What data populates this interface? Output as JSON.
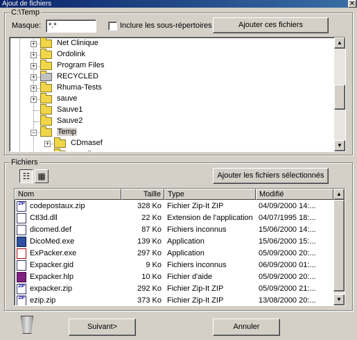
{
  "window": {
    "title": "Ajout de fichiers",
    "close_glyph": "✕"
  },
  "top_group": {
    "label": "C:\\Temp",
    "mask_label": "Masque:",
    "mask_value": "*.*",
    "include_subdirs_label": "Inclure les sous-répertoires",
    "include_subdirs_checked": false,
    "add_button": "Ajouter ces fichiers"
  },
  "tree": {
    "items": [
      {
        "label": "Net Clinique",
        "expandable": true
      },
      {
        "label": "Ordolink",
        "expandable": true
      },
      {
        "label": "Program Files",
        "expandable": true
      },
      {
        "label": "RECYCLED",
        "expandable": true,
        "icon": "recycle-bin-icon"
      },
      {
        "label": "Rhuma-Tests",
        "expandable": true
      },
      {
        "label": "sauve",
        "expandable": true
      },
      {
        "label": "Sauve1",
        "expandable": false
      },
      {
        "label": "Sauve2",
        "expandable": false
      },
      {
        "label": "Temp",
        "expandable": true,
        "expanded": true,
        "selected": true
      },
      {
        "label": "CDmasef",
        "expandable": true,
        "child": true
      },
      {
        "label": "travail",
        "expandable": false,
        "child": true
      }
    ]
  },
  "files_group": {
    "label": "Fichiers",
    "add_selected_button": "Ajouter les fichiers sélectionnés",
    "columns": [
      "Nom",
      "Taille",
      "Type",
      "Modifié"
    ],
    "rows": [
      {
        "name": "codepostaux.zip",
        "size": "328 Ko",
        "type": "Fichier Zip-It ZIP",
        "modified": "04/09/2000 14:...",
        "icon": "zip"
      },
      {
        "name": "Ctl3d.dll",
        "size": "22 Ko",
        "type": "Extension de l'application",
        "modified": "04/07/1995 18:...",
        "icon": "dll"
      },
      {
        "name": "dicomed.def",
        "size": "87 Ko",
        "type": "Fichiers inconnus",
        "modified": "15/06/2000 14:...",
        "icon": "def"
      },
      {
        "name": "DicoMed.exe",
        "size": "139 Ko",
        "type": "Application",
        "modified": "15/06/2000 15:...",
        "icon": "app"
      },
      {
        "name": "ExPacker.exe",
        "size": "297 Ko",
        "type": "Application",
        "modified": "05/09/2000 20:...",
        "icon": "exe"
      },
      {
        "name": "Expacker.gid",
        "size": "9 Ko",
        "type": "Fichiers inconnus",
        "modified": "06/09/2000 01:...",
        "icon": "gid"
      },
      {
        "name": "Expacker.hlp",
        "size": "10 Ko",
        "type": "Fichier d'aide",
        "modified": "05/09/2000 20:...",
        "icon": "help"
      },
      {
        "name": "expacker.zip",
        "size": "292 Ko",
        "type": "Fichier Zip-It ZIP",
        "modified": "05/09/2000 21:...",
        "icon": "zip"
      },
      {
        "name": "ezip.zip",
        "size": "373 Ko",
        "type": "Fichier Zip-It ZIP",
        "modified": "13/08/2000 20:...",
        "icon": "zip"
      }
    ]
  },
  "footer": {
    "next_button": "Suivant>",
    "cancel_button": "Annuler"
  },
  "icons": {
    "scroll_up": "▲",
    "scroll_down": "▼",
    "zip_label": "ZIP",
    "list_view": "☷",
    "detail_view": "▦"
  }
}
